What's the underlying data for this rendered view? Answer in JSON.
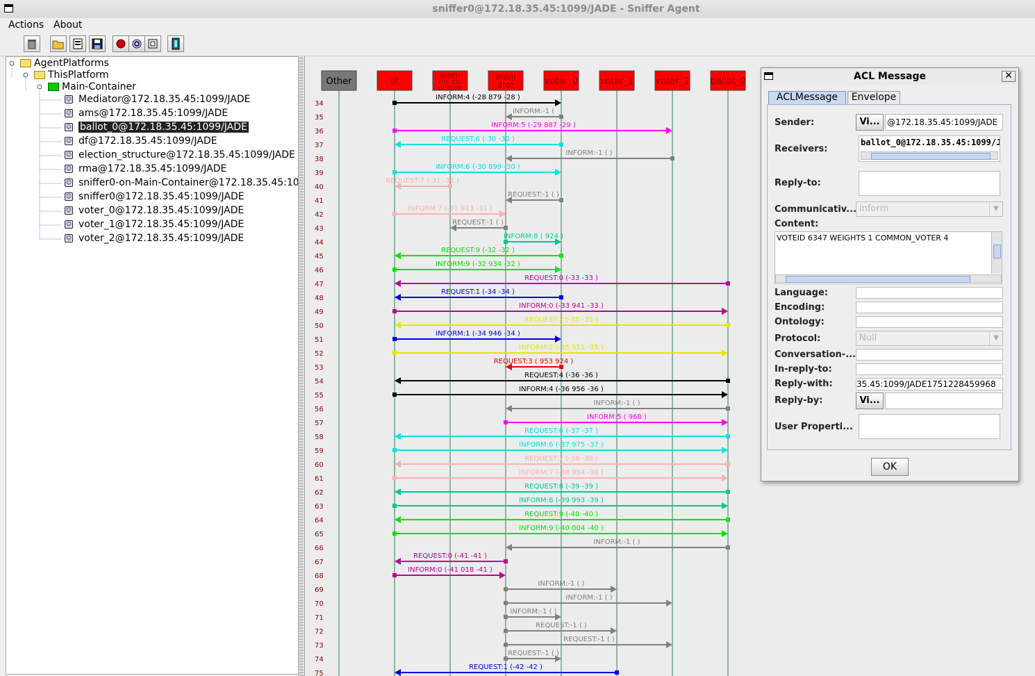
{
  "window": {
    "title": "sniffer0@172.18.35.45:1099/JADE - Sniffer Agent"
  },
  "menu": [
    "Actions",
    "About"
  ],
  "toolbar_icons": [
    "clear-canvas-icon",
    "open-snapshot-icon",
    "write-messages-icon",
    "save-snapshot-icon",
    "do-sniff-icon",
    "do-not-sniff-icon",
    "show-only-icon",
    "exit-icon"
  ],
  "tree": {
    "root": "AgentPlatforms",
    "platform": "ThisPlatform",
    "container": "Main-Container",
    "agents": [
      "Mediator@172.18.35.45:1099/JADE",
      "ams@172.18.35.45:1099/JADE",
      "ballot_0@172.18.35.45:1099/JADE",
      "df@172.18.35.45:1099/JADE",
      "election_structure@172.18.35.45:1099/JADE",
      "rma@172.18.35.45:1099/JADE",
      "sniffer0-on-Main-Container@172.18.35.45:10",
      "sniffer0@172.18.35.45:1099/JADE",
      "voter_0@172.18.35.45:1099/JADE",
      "voter_1@172.18.35.45:1099/JADE",
      "voter_2@172.18.35.45:1099/JADE"
    ],
    "selected": 2
  },
  "lifelines": [
    {
      "lines": [
        "Other"
      ],
      "color": "#777777",
      "text_color": "#000000"
    },
    {
      "lines": [
        "df"
      ],
      "color": "#ff0000",
      "text_color": "#8b0000"
    },
    {
      "lines": [
        "electi",
        "on_str",
        "ucture"
      ],
      "color": "#ff0000",
      "text_color": "#8b0000"
    },
    {
      "lines": [
        "Medi",
        "ator"
      ],
      "color": "#ff0000",
      "text_color": "#8b0000"
    },
    {
      "lines": [
        "voter_0"
      ],
      "color": "#ff0000",
      "text_color": "#8b0000"
    },
    {
      "lines": [
        "voter_1"
      ],
      "color": "#ff0000",
      "text_color": "#8b0000"
    },
    {
      "lines": [
        "voter_2"
      ],
      "color": "#ff0000",
      "text_color": "#8b0000"
    },
    {
      "lines": [
        "ballot_0"
      ],
      "color": "#ff0000",
      "text_color": "#8b0000"
    }
  ],
  "messages": [
    {
      "n": "34",
      "from": 1,
      "to": 4,
      "label": "INFORM:4 (-28  879  -28 )",
      "color": "#000000"
    },
    {
      "n": "35",
      "from": 4,
      "to": 3,
      "label": "INFORM:-1 (",
      "color": "#808080"
    },
    {
      "n": "36",
      "from": 1,
      "to": 6,
      "label": "INFORM:5 (-29  887  -29 )",
      "color": "#ff00ff"
    },
    {
      "n": "37",
      "from": 4,
      "to": 1,
      "label": "REQUEST:6 (-30  -30   )",
      "color": "#00e5e5"
    },
    {
      "n": "38",
      "from": 6,
      "to": 3,
      "label": "INFORM:-1 (        )",
      "color": "#808080"
    },
    {
      "n": "39",
      "from": 1,
      "to": 4,
      "label": "INFORM:6 (-30  899  -30 )",
      "color": "#00e5e5"
    },
    {
      "n": "40",
      "from": 2,
      "to": 1,
      "label": "REQUEST:7 (-31  -31   )",
      "color": "#ffafaf"
    },
    {
      "n": "41",
      "from": 4,
      "to": 3,
      "label": "REQUEST:-1 (        )",
      "color": "#808080"
    },
    {
      "n": "42",
      "from": 1,
      "to": 3,
      "label": "INFORM:7 (-31  913  -31 )",
      "color": "#ffafaf"
    },
    {
      "n": "43",
      "from": 3,
      "to": 2,
      "label": "REQUEST:-1 (        )",
      "color": "#808080"
    },
    {
      "n": "44",
      "from": 3,
      "to": 4,
      "label": "INFORM:8 (   924    )",
      "color": "#00c896"
    },
    {
      "n": "45",
      "from": 4,
      "to": 1,
      "label": "REQUEST:9 (-32  -32   )",
      "color": "#00e600"
    },
    {
      "n": "46",
      "from": 1,
      "to": 4,
      "label": "INFORM:9 (-32  934  -32 )",
      "color": "#00e600"
    },
    {
      "n": "47",
      "from": 7,
      "to": 1,
      "label": "REQUEST:0 (-33  -33   )",
      "color": "#c00096"
    },
    {
      "n": "48",
      "from": 4,
      "to": 1,
      "label": "REQUEST:1 (-34  -34   )",
      "color": "#0000e0"
    },
    {
      "n": "49",
      "from": 1,
      "to": 7,
      "label": "INFORM:0 (-33  941  -33 )",
      "color": "#c00096"
    },
    {
      "n": "50",
      "from": 7,
      "to": 1,
      "label": "REQUEST:2 (-35  -35   )",
      "color": "#e6e600"
    },
    {
      "n": "51",
      "from": 1,
      "to": 4,
      "label": "INFORM:1 (-34  946  -34 )",
      "color": "#0000e0"
    },
    {
      "n": "52",
      "from": 1,
      "to": 7,
      "label": "INFORM:2 (-35  951  -35 )",
      "color": "#e6e600"
    },
    {
      "n": "53",
      "from": 4,
      "to": 3,
      "label": "REQUEST:3 (   953  924 )",
      "color": "#e60000"
    },
    {
      "n": "54",
      "from": 7,
      "to": 1,
      "label": "REQUEST:4 (-36  -36   )",
      "color": "#000000"
    },
    {
      "n": "55",
      "from": 1,
      "to": 7,
      "label": "INFORM:4 (-36  956  -36 )",
      "color": "#000000"
    },
    {
      "n": "56",
      "from": 7,
      "to": 3,
      "label": "INFORM:-1 (        )",
      "color": "#808080"
    },
    {
      "n": "57",
      "from": 3,
      "to": 7,
      "label": "INFORM:5 (   968    )",
      "color": "#ff00ff"
    },
    {
      "n": "58",
      "from": 7,
      "to": 1,
      "label": "REQUEST:6 (-37  -37   )",
      "color": "#00e5e5"
    },
    {
      "n": "59",
      "from": 1,
      "to": 7,
      "label": "INFORM:6 (-37  975  -37 )",
      "color": "#00e5e5"
    },
    {
      "n": "60",
      "from": 7,
      "to": 1,
      "label": "REQUEST:7 (-38  -38   )",
      "color": "#ffafaf"
    },
    {
      "n": "61",
      "from": 1,
      "to": 7,
      "label": "INFORM:7 (-38  984  -38 )",
      "color": "#ffafaf"
    },
    {
      "n": "62",
      "from": 7,
      "to": 1,
      "label": "REQUEST:8 (-39  -39   )",
      "color": "#00c896"
    },
    {
      "n": "63",
      "from": 1,
      "to": 7,
      "label": "INFORM:8 (-39  993  -39 )",
      "color": "#00c896"
    },
    {
      "n": "64",
      "from": 7,
      "to": 1,
      "label": "REQUEST:9 (-40  -40   )",
      "color": "#00e600"
    },
    {
      "n": "65",
      "from": 1,
      "to": 7,
      "label": "INFORM:9 (-40  004  -40 )",
      "color": "#00e600"
    },
    {
      "n": "66",
      "from": 7,
      "to": 3,
      "label": "INFORM:-1 (        )",
      "color": "#808080"
    },
    {
      "n": "67",
      "from": 3,
      "to": 1,
      "label": "REQUEST:0 (-41  -41   )",
      "color": "#c00096"
    },
    {
      "n": "68",
      "from": 1,
      "to": 3,
      "label": "INFORM:0 (-41  018  -41 )",
      "color": "#c00096"
    },
    {
      "n": "69",
      "from": 3,
      "to": 5,
      "label": "INFORM:-1 (        )",
      "color": "#808080"
    },
    {
      "n": "70",
      "from": 3,
      "to": 6,
      "label": "INFORM:-1 (        )",
      "color": "#808080"
    },
    {
      "n": "71",
      "from": 3,
      "to": 4,
      "label": "INFORM:-1 (        )",
      "color": "#808080"
    },
    {
      "n": "72",
      "from": 3,
      "to": 5,
      "label": "REQUEST:-1 (        )",
      "color": "#808080"
    },
    {
      "n": "73",
      "from": 3,
      "to": 6,
      "label": "REQUEST:-1 (        )",
      "color": "#808080"
    },
    {
      "n": "74",
      "from": 3,
      "to": 4,
      "label": "REQUEST:-1 (        )",
      "color": "#808080"
    },
    {
      "n": "75",
      "from": 5,
      "to": 1,
      "label": "REQUEST:1 (-42  -42   )",
      "color": "#0000e0"
    }
  ],
  "dialog": {
    "title": "ACL Message",
    "close_glyph": "✕",
    "tabs": [
      "ACLMessage",
      "Envelope"
    ],
    "labels": {
      "sender": "Sender:",
      "receivers": "Receivers:",
      "reply_to": "Reply-to:",
      "communicative": "Communicativ...",
      "content": "Content:",
      "language": "Language:",
      "encoding": "Encoding:",
      "ontology": "Ontology:",
      "protocol": "Protocol:",
      "conversation": "Conversation-...",
      "in_reply_to": "In-reply-to:",
      "reply_with": "Reply-with:",
      "reply_by": "Reply-by:",
      "user_properties": "User Properti..."
    },
    "view_button": "Vi...",
    "sender_value": "@172.18.35.45:1099/JADE",
    "receiver_value": "ballot_0@172.18.35.45:1099/JA",
    "performative": "inform",
    "content_value": "VOTEID 6347 WEIGHTS 1 COMMON_VOTER 4",
    "protocol": "Null",
    "reply_with_value": "35.45:1099/JADE1751228459968",
    "ok": "OK"
  }
}
